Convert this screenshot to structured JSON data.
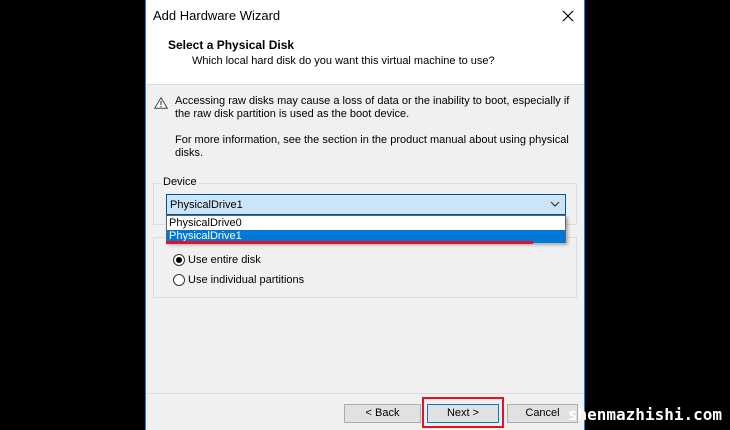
{
  "window": {
    "title": "Add Hardware Wizard"
  },
  "header": {
    "title": "Select a Physical Disk",
    "subtitle": "Which local hard disk do you want this virtual machine to use?"
  },
  "content": {
    "warning": "Accessing raw disks may cause a loss of data or the inability to boot, especially if the raw disk partition is used as the boot device.",
    "info": "For more information, see the section in the product manual about using physical disks."
  },
  "device": {
    "label": "Device",
    "selected": "PhysicalDrive1",
    "options": [
      "PhysicalDrive0",
      "PhysicalDrive1"
    ]
  },
  "usage": {
    "options": [
      {
        "label": "Use entire disk",
        "checked": true
      },
      {
        "label": "Use individual partitions",
        "checked": false
      }
    ]
  },
  "buttons": {
    "back": "< Back",
    "next": "Next >",
    "cancel": "Cancel"
  },
  "watermark": "shenmazhishi.com",
  "colors": {
    "accent": "#0078d7",
    "highlight": "#e81123",
    "combo_bg": "#cce4f7"
  }
}
